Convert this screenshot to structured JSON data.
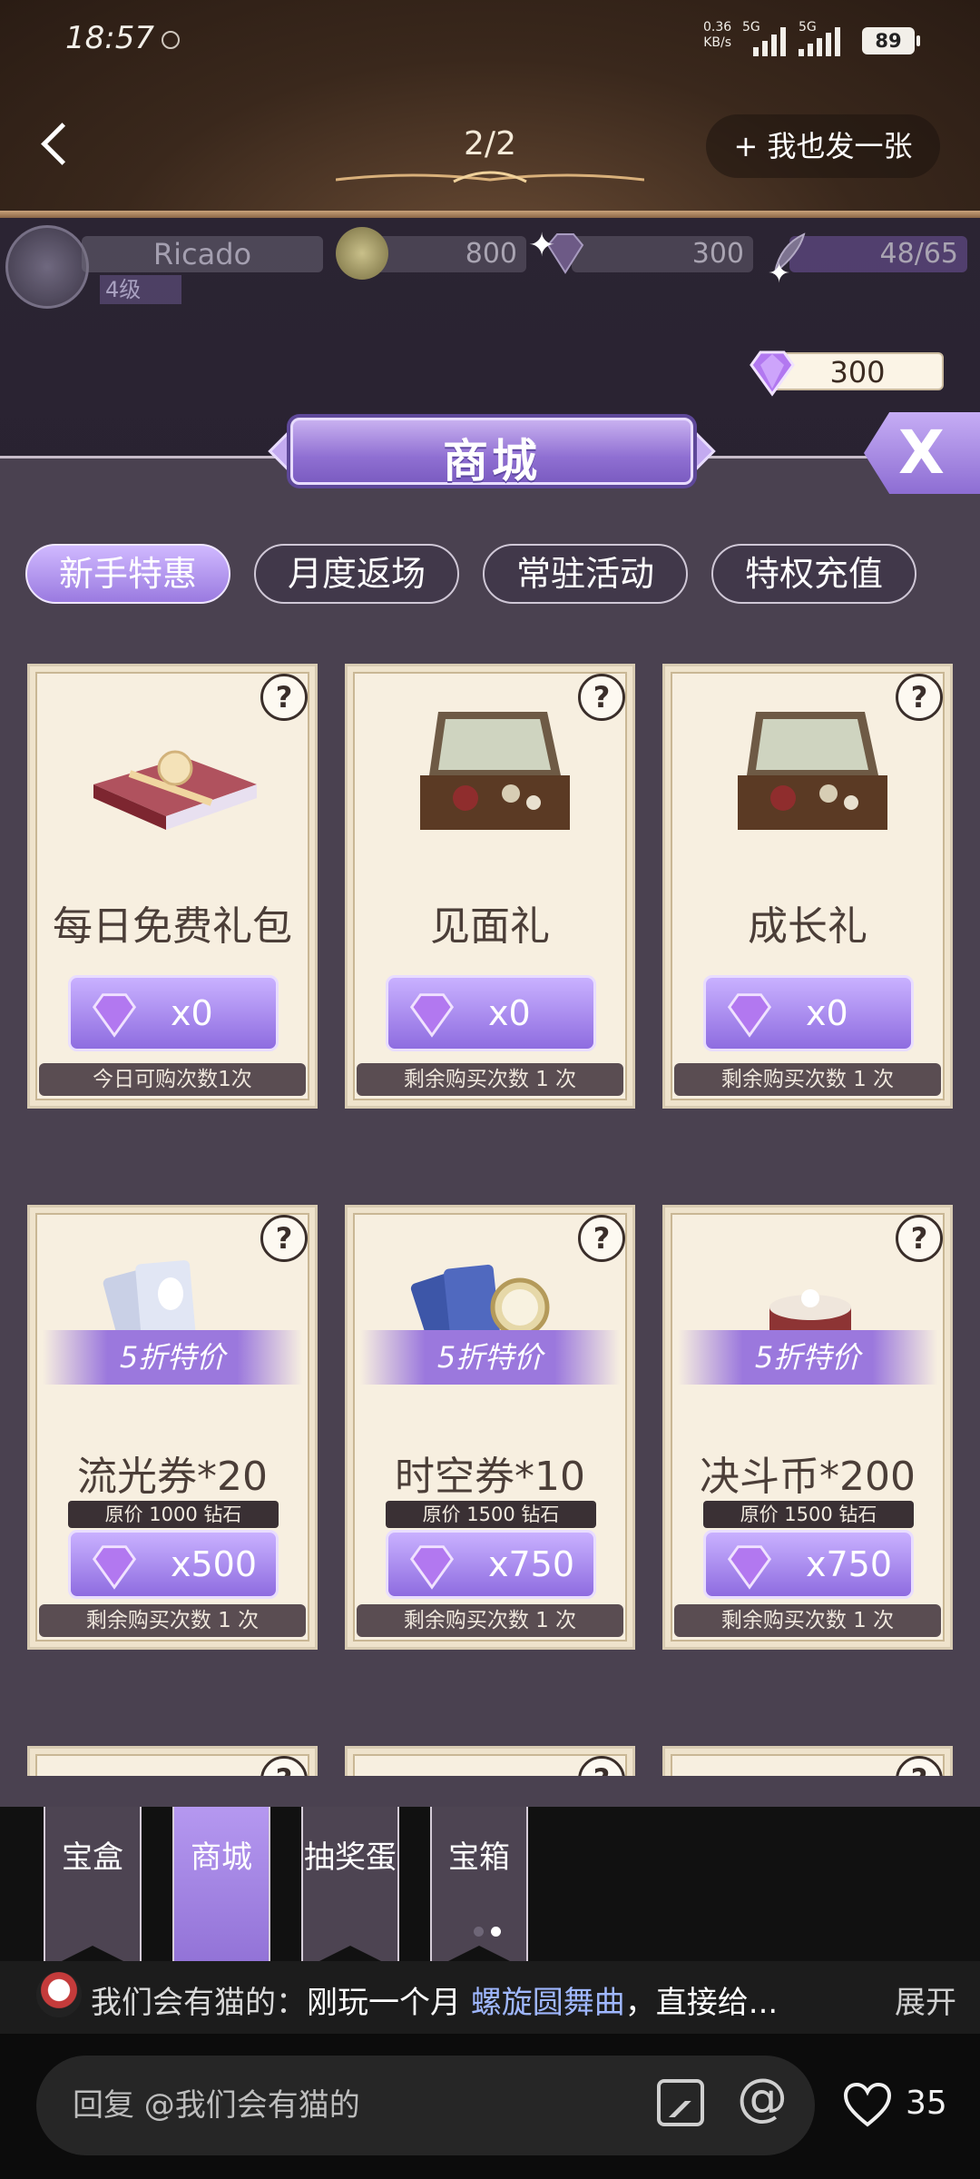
{
  "status": {
    "time": "18:57",
    "net_speed": "0.36\nKB/s",
    "sig1": "5G",
    "sig2": "5G",
    "battery": "89"
  },
  "header": {
    "page": "2/2",
    "post_button": "+ 我也发一张"
  },
  "profile": {
    "name": "Ricado",
    "level": "4级",
    "gold": "800",
    "diamond": "300",
    "stamina": "48/65"
  },
  "gem_balance": "300",
  "mall": {
    "title": "商城",
    "close": "X",
    "tabs": [
      "新手特惠",
      "月度返场",
      "常驻活动",
      "特权充值"
    ],
    "cards": [
      {
        "name": "每日免费礼包",
        "price": "x0",
        "remain": "今日可购次数1次",
        "art": "gift-box"
      },
      {
        "name": "见面礼",
        "price": "x0",
        "remain": "剩余购买次数 1 次",
        "art": "suitcase"
      },
      {
        "name": "成长礼",
        "price": "x0",
        "remain": "剩余购买次数 1 次",
        "art": "suitcase"
      },
      {
        "name": "流光券*20",
        "price": "x500",
        "remain": "剩余购买次数 1 次",
        "discount": "5折特价",
        "orig": "原价 1000 钻石",
        "art": "silver-tickets"
      },
      {
        "name": "时空券*10",
        "price": "x750",
        "remain": "剩余购买次数 1 次",
        "discount": "5折特价",
        "orig": "原价 1500 钻石",
        "art": "blue-tickets"
      },
      {
        "name": "决斗币*200",
        "price": "x750",
        "remain": "剩余购买次数 1 次",
        "discount": "5折特价",
        "orig": "原价 1500 钻石",
        "art": "cake"
      }
    ],
    "help": "?"
  },
  "bottom_tabs": [
    "宝盒",
    "商城",
    "抽奖蛋",
    "宝箱"
  ],
  "comment": {
    "user": "我们会有猫的：",
    "text": "刚玩一个月 ",
    "tag": "螺旋圆舞曲",
    "tail": "，直接给...",
    "expand": "展开"
  },
  "reply": {
    "placeholder": "回复 @我们会有猫的",
    "likes": "35"
  },
  "colors": {
    "accent": "#9a7ae0",
    "card_bg": "#f7efe0",
    "panel_bg": "#4a4150"
  }
}
